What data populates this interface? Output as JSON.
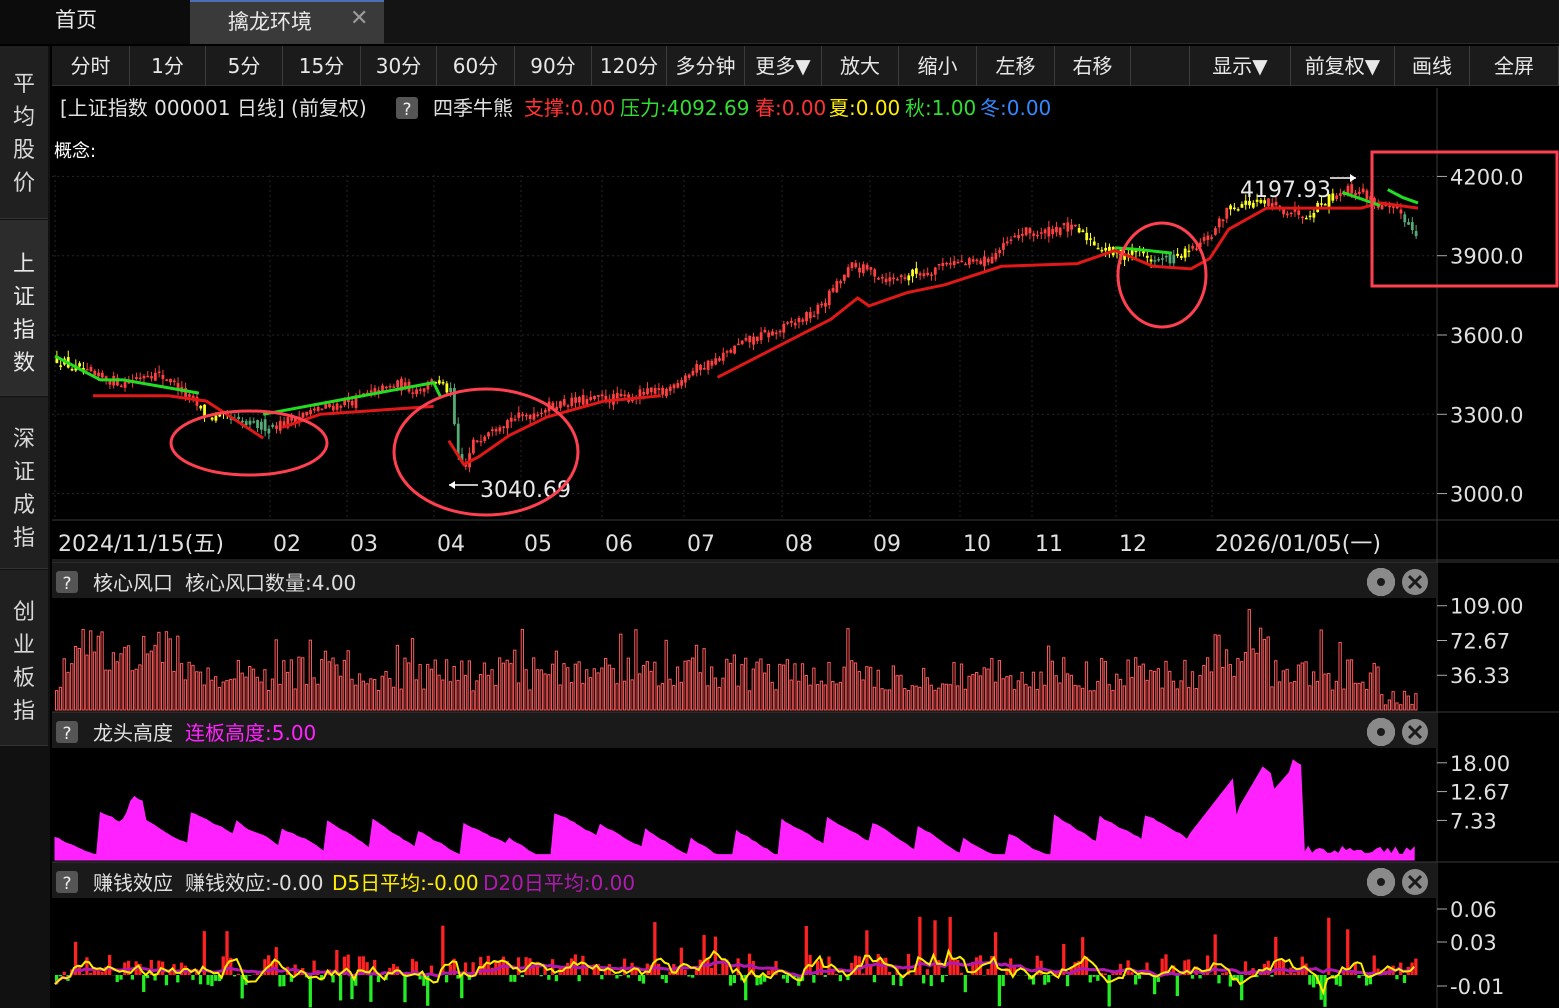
{
  "tabs": [
    {
      "label": "首页"
    },
    {
      "label": "擒龙环境"
    }
  ],
  "sidebar": {
    "items": [
      {
        "chars": [
          "平",
          "均",
          "股",
          "价"
        ]
      },
      {
        "chars": [
          "上",
          "证",
          "指",
          "数"
        ]
      },
      {
        "chars": [
          "深",
          "证",
          "成",
          "指"
        ]
      },
      {
        "chars": [
          "创",
          "业",
          "板",
          "指"
        ]
      }
    ]
  },
  "toolbar": {
    "buttons": [
      "分时",
      "1分",
      "5分",
      "15分",
      "30分",
      "60分",
      "90分",
      "120分",
      "多分钟",
      "更多▼",
      "放大",
      "缩小",
      "左移",
      "右移",
      "",
      "显示▼",
      "前复权▼",
      "画线",
      "全屏"
    ]
  },
  "main_header": {
    "title": "[上证指数 000001 日线] (前复权)",
    "help": "?",
    "indicator": "四季牛熊",
    "items": [
      {
        "label": "支撑:0.00",
        "color": "#ff3333"
      },
      {
        "label": "压力:4092.69",
        "color": "#33dd33"
      },
      {
        "label": "春:0.00",
        "color": "#ff3333"
      },
      {
        "label": "夏:0.00",
        "color": "#ffee00"
      },
      {
        "label": "秋:1.00",
        "color": "#33dd33"
      },
      {
        "label": "冬:0.00",
        "color": "#3388ff"
      }
    ],
    "concept_label": "概念:"
  },
  "chart_data": [
    {
      "type": "candlestick",
      "title": "[上证指数 000001 日线] (前复权)",
      "ylim": [
        2900,
        4300
      ],
      "yticks": [
        "4200.0",
        "3900.0",
        "3600.0",
        "3300.0",
        "3000.0"
      ],
      "xticks": [
        "2024/11/15(五)",
        "02",
        "03",
        "04",
        "05",
        "06",
        "07",
        "08",
        "09",
        "10",
        "11",
        "12",
        "2026/01/05(一)"
      ],
      "annotations": [
        "3040.69",
        "4197.93"
      ],
      "close_path": [
        [
          0,
          3510
        ],
        [
          5,
          3470
        ],
        [
          10,
          3440
        ],
        [
          18,
          3420
        ],
        [
          24,
          3460
        ],
        [
          30,
          3430
        ],
        [
          40,
          3290
        ],
        [
          45,
          3280
        ],
        [
          50,
          3260
        ],
        [
          55,
          3255
        ],
        [
          60,
          3268
        ],
        [
          65,
          3300
        ],
        [
          70,
          3320
        ],
        [
          75,
          3340
        ],
        [
          80,
          3360
        ],
        [
          85,
          3390
        ],
        [
          90,
          3410
        ],
        [
          95,
          3395
        ],
        [
          100,
          3430
        ],
        [
          104,
          3380
        ],
        [
          106,
          3130
        ],
        [
          108,
          3100
        ],
        [
          110,
          3190
        ],
        [
          115,
          3260
        ],
        [
          120,
          3280
        ],
        [
          125,
          3300
        ],
        [
          130,
          3330
        ],
        [
          135,
          3345
        ],
        [
          140,
          3350
        ],
        [
          145,
          3360
        ],
        [
          150,
          3360
        ],
        [
          155,
          3380
        ],
        [
          160,
          3380
        ],
        [
          165,
          3440
        ],
        [
          170,
          3480
        ],
        [
          175,
          3510
        ],
        [
          180,
          3560
        ],
        [
          185,
          3590
        ],
        [
          190,
          3610
        ],
        [
          195,
          3650
        ],
        [
          200,
          3680
        ],
        [
          205,
          3770
        ],
        [
          210,
          3860
        ],
        [
          215,
          3840
        ],
        [
          220,
          3810
        ],
        [
          225,
          3830
        ],
        [
          230,
          3840
        ],
        [
          235,
          3880
        ],
        [
          240,
          3870
        ],
        [
          245,
          3880
        ],
        [
          250,
          3930
        ],
        [
          255,
          3990
        ],
        [
          260,
          3980
        ],
        [
          265,
          4010
        ],
        [
          270,
          3990
        ],
        [
          275,
          3940
        ],
        [
          280,
          3900
        ],
        [
          285,
          3920
        ],
        [
          290,
          3880
        ],
        [
          295,
          3890
        ],
        [
          300,
          3920
        ],
        [
          305,
          3980
        ],
        [
          310,
          4090
        ],
        [
          315,
          4100
        ],
        [
          320,
          4090
        ],
        [
          325,
          4070
        ],
        [
          330,
          4060
        ],
        [
          335,
          4110
        ],
        [
          340,
          4150
        ],
        [
          345,
          4140
        ],
        [
          350,
          4080
        ],
        [
          355,
          4060
        ],
        [
          360,
          3970
        ]
      ],
      "support_line": [
        [
          10,
          3370
        ],
        [
          30,
          3370
        ],
        [
          40,
          3350
        ],
        [
          55,
          3210
        ],
        [
          60,
          3250
        ],
        [
          70,
          3300
        ],
        [
          100,
          3330
        ],
        [
          104,
          3200
        ],
        [
          108,
          3110
        ],
        [
          112,
          3140
        ],
        [
          120,
          3220
        ],
        [
          130,
          3290
        ],
        [
          145,
          3350
        ],
        [
          160,
          3370
        ],
        [
          175,
          3440
        ],
        [
          190,
          3550
        ],
        [
          205,
          3660
        ],
        [
          212,
          3740
        ],
        [
          215,
          3710
        ],
        [
          225,
          3760
        ],
        [
          235,
          3790
        ],
        [
          250,
          3860
        ],
        [
          270,
          3870
        ],
        [
          280,
          3920
        ],
        [
          290,
          3860
        ],
        [
          300,
          3850
        ],
        [
          305,
          3890
        ],
        [
          310,
          4000
        ],
        [
          320,
          4080
        ],
        [
          345,
          4080
        ],
        [
          350,
          4100
        ],
        [
          360,
          4080
        ]
      ],
      "resistance_line": [
        [
          0,
          3520
        ],
        [
          8,
          3460
        ],
        [
          12,
          3430
        ],
        [
          18,
          3430
        ],
        [
          38,
          3380
        ],
        [
          40,
          3320
        ],
        [
          55,
          3300
        ],
        [
          100,
          3420
        ],
        [
          102,
          3360
        ],
        [
          108,
          3340
        ],
        [
          280,
          3990
        ],
        [
          282,
          3930
        ],
        [
          295,
          3910
        ],
        [
          315,
          4100
        ],
        [
          333,
          4110
        ],
        [
          340,
          4140
        ],
        [
          350,
          4090
        ],
        [
          355,
          4160
        ],
        [
          360,
          4100
        ]
      ]
    },
    {
      "type": "bar",
      "title": "核心风口",
      "label": "核心风口数量:4.00",
      "ylim": [
        0,
        115
      ],
      "yticks": [
        "109.00",
        "72.67",
        "36.33"
      ],
      "color": "#ff5a5a"
    },
    {
      "type": "area",
      "title": "龙头高度",
      "label": "连板高度:5.00",
      "ylim": [
        0,
        20
      ],
      "yticks": [
        "18.00",
        "12.67",
        "7.33"
      ],
      "color": "#ff22ff"
    },
    {
      "type": "bar",
      "title": "赚钱效应",
      "series": [
        {
          "name": "赚钱效应:-0.00",
          "color": "#dddddd"
        },
        {
          "name": "D5日平均:-0.00",
          "color": "#ffee00"
        },
        {
          "name": "D20日平均:0.00",
          "color": "#b01ab0"
        }
      ],
      "ylim": [
        -0.03,
        0.07
      ],
      "yticks": [
        "0.06",
        "0.03",
        "-0.01"
      ]
    }
  ],
  "panels": [
    {
      "help": "?",
      "title": "核心风口",
      "items": [
        {
          "label": "核心风口数量:4.00",
          "color": "#dddddd"
        }
      ]
    },
    {
      "help": "?",
      "title": "龙头高度",
      "items": [
        {
          "label": "连板高度:5.00",
          "color": "#ff22ff"
        }
      ]
    },
    {
      "help": "?",
      "title": "赚钱效应",
      "items": [
        {
          "label": "赚钱效应:-0.00",
          "color": "#dddddd"
        },
        {
          "label": "D5日平均:-0.00",
          "color": "#ffee00"
        },
        {
          "label": "D20日平均:0.00",
          "color": "#b01ab0"
        }
      ]
    }
  ],
  "colors": {
    "up": "#ff4040",
    "down": "#33cc33",
    "yellow": "#ffff22",
    "teal": "#55aa77",
    "annotation": "#ff4050",
    "axis_text": "#e0e0e0"
  },
  "icons": [
    "gear-icon",
    "close-circle-icon",
    "help-icon",
    "close-icon"
  ]
}
